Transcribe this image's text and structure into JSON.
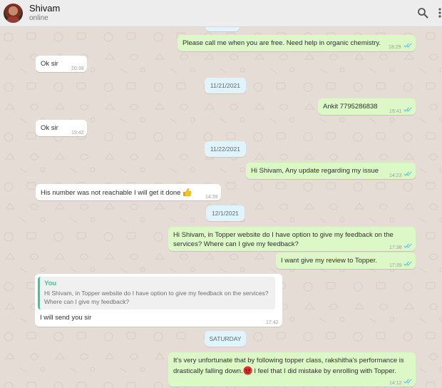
{
  "header": {
    "contact_name": "Shivam",
    "status": "online",
    "icons": [
      "avatar",
      "search-icon",
      "menu-icon"
    ]
  },
  "colors": {
    "outgoing_bubble": "#dcf8c6",
    "incoming_bubble": "#ffffff",
    "read_ticks": "#4fc3f7",
    "date_pill": "#e1f3fb",
    "quote_accent": "#35cd96"
  },
  "messages": {
    "m1": {
      "text": "Please call me when you are free. Need help in organic chemistry.",
      "time": "18:29"
    },
    "m2": {
      "text": "Ok sir",
      "time": "20:39"
    },
    "d1": "11/21/2021",
    "m3": {
      "text": "Ankit 7795286838",
      "time": "19:41"
    },
    "m4": {
      "text": "Ok sir",
      "time": "19:42"
    },
    "d2": "11/22/2021",
    "m5": {
      "text": "Hi Shivam, Any update regarding my issue",
      "time": "14:23"
    },
    "m6": {
      "text": "His number was not reachable I will get it done",
      "time": "14:39",
      "emoji": "thumbs-up"
    },
    "d3": "12/1/2021",
    "m7": {
      "line1": "Hi Shivam, in Topper website do I have option to give my feedback on the",
      "line2": "services? Where can I give my feedback?",
      "time": "17:38"
    },
    "m8": {
      "text": "I want give my review to Topper.",
      "time": "17:39"
    },
    "m9": {
      "quote_author": "You",
      "quote_line1": "Hi Shivam, in Topper website do I have option to give my feedback on the services?",
      "quote_line2": "Where can I give my feedback?",
      "text": "I will send you sir",
      "time": "17:42"
    },
    "d4": "SATURDAY",
    "m10": {
      "line1": "It's very unfortunate that by following topper class, rakshitha's performance is",
      "line2_a": "drastically falling down.",
      "line2_b": " I feel that I did mistake by enrolling with Topper.",
      "emoji": "angry-face",
      "time": "14:12"
    }
  }
}
